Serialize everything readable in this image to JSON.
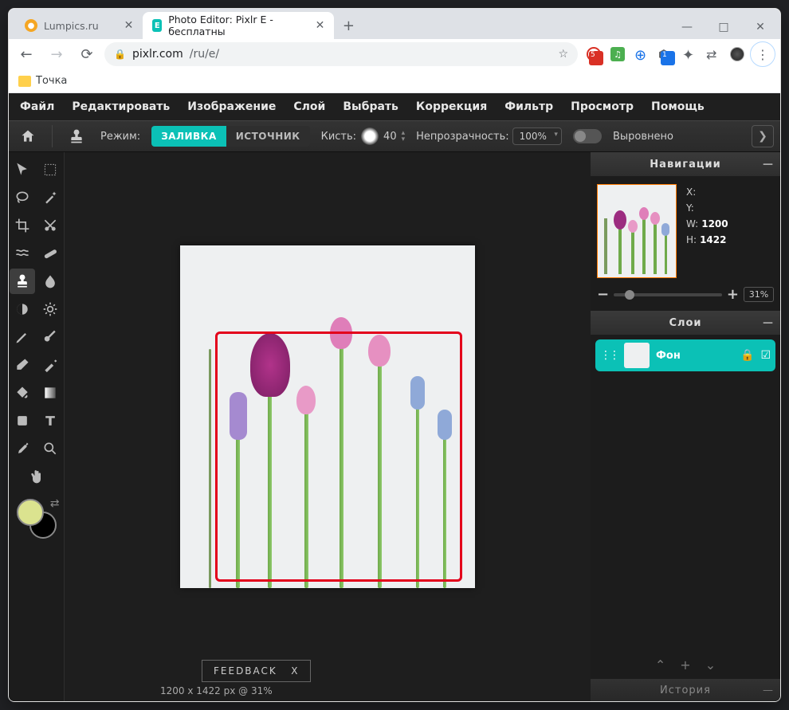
{
  "browser": {
    "tabs": [
      {
        "title": "Lumpics.ru",
        "active": false
      },
      {
        "title": "Photo Editor: Pixlr E - бесплатны",
        "active": true
      }
    ],
    "nav": {
      "back": "←",
      "forward": "→",
      "reload": "⟳"
    },
    "url_host": "pixlr.com",
    "url_path": "/ru/e/",
    "bookmark_folder": "Точка",
    "ext_badge_red": "5",
    "ext_badge_blue": "1"
  },
  "window": {
    "min": "—",
    "max": "□",
    "close": "✕"
  },
  "menu": {
    "file": "Файл",
    "edit": "Редактировать",
    "image": "Изображение",
    "layer": "Слой",
    "select": "Выбрать",
    "adjust": "Коррекция",
    "filter": "Фильтр",
    "view": "Просмотр",
    "help": "Помощь"
  },
  "options": {
    "mode_label": "Режим:",
    "fill": "ЗАЛИВКА",
    "source": "ИСТОЧНИК",
    "brush_label": "Кисть:",
    "brush_size": "40",
    "opacity_label": "Непрозрачность:",
    "opacity_value": "100%",
    "aligned": "Выровнено"
  },
  "nav_panel": {
    "title": "Навигации",
    "x": "X:",
    "y": "Y:",
    "w": "W:",
    "w_val": "1200",
    "h": "H:",
    "h_val": "1422",
    "zoom": "31%",
    "minus": "−",
    "plus": "+"
  },
  "layers_panel": {
    "title": "Слои",
    "layer_name": "Фон",
    "up": "⌃",
    "add": "+",
    "down": "⌄"
  },
  "history_panel": {
    "title": "История"
  },
  "status": {
    "dims": "1200 x 1422 px @ 31%"
  },
  "feedback": {
    "label": "FEEDBACK",
    "close": "X"
  }
}
